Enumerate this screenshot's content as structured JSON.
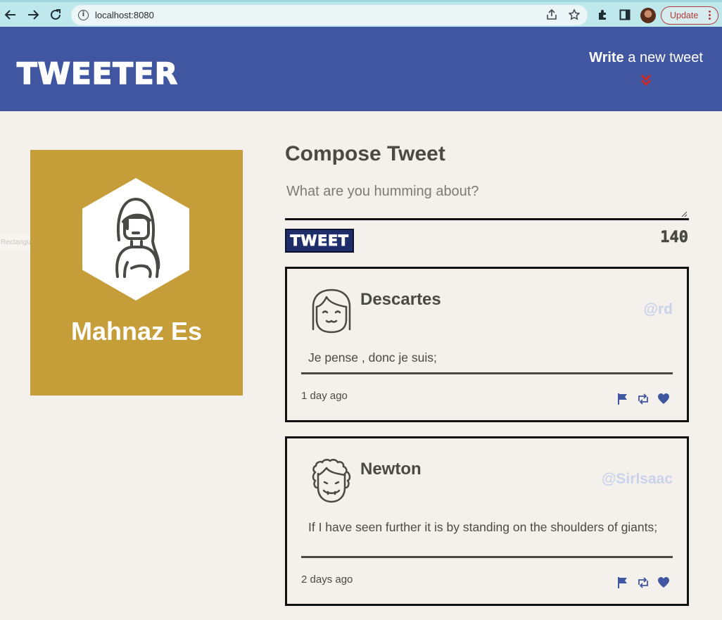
{
  "browser": {
    "url": "localhost:8080",
    "update_label": "Update",
    "icons": [
      "back-arrow-icon",
      "forward-arrow-icon",
      "reload-icon",
      "info-icon",
      "share-icon",
      "star-icon",
      "extensions-icon",
      "side-panel-icon",
      "profile-avatar",
      "more-menu-icon"
    ]
  },
  "header": {
    "brand": "TWEETER",
    "write_bold": "Write",
    "write_rest": " a new tweet",
    "chevron_icon": "double-chevron-down-icon",
    "colors": {
      "bar": "#4056a1",
      "chevron": "#cc2a2a"
    }
  },
  "profile": {
    "name": "Mahnaz Es",
    "avatar_icon": "woman-avatar-icon",
    "card_color": "#c69e39",
    "ghost_label": "Rectangular Snip"
  },
  "compose": {
    "title": "Compose Tweet",
    "placeholder": "What are you humming about?",
    "button_label": "TWEET",
    "counter": "140"
  },
  "tweets": [
    {
      "name": "Descartes",
      "handle": "@rd",
      "text": "Je pense , donc je suis;",
      "time": "1 day ago",
      "avatar_icon": "girl-avatar-icon"
    },
    {
      "name": "Newton",
      "handle": "@SirIsaac",
      "text": "If I have seen further it is by standing on the shoulders of giants;",
      "time": "2 days ago",
      "avatar_icon": "curly-hair-avatar-icon"
    }
  ],
  "tweet_actions": [
    "flag-icon",
    "retweet-icon",
    "heart-icon"
  ]
}
